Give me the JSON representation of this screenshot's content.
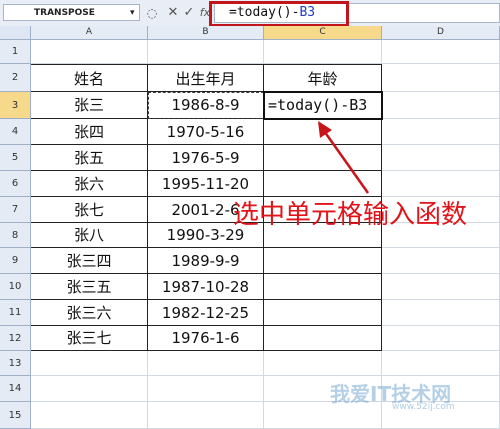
{
  "formula_bar": {
    "name_box": "TRANSPOSE",
    "cancel_icon": "✕",
    "enter_icon": "✓",
    "fx_icon": "fx",
    "formula_prefix": "=today()-",
    "formula_ref": "B3"
  },
  "columns": [
    "A",
    "B",
    "C",
    "D"
  ],
  "selected_column": "C",
  "rows": [
    "1",
    "2",
    "3",
    "4",
    "5",
    "6",
    "7",
    "8",
    "9",
    "10",
    "11",
    "12",
    "13",
    "14",
    "15"
  ],
  "selected_row": "3",
  "table": {
    "headers": [
      "姓名",
      "出生年月",
      "年龄"
    ],
    "records": [
      {
        "name": "张三",
        "birth": "1986-8-9",
        "age": "=today()-B3"
      },
      {
        "name": "张四",
        "birth": "1970-5-16",
        "age": ""
      },
      {
        "name": "张五",
        "birth": "1976-5-9",
        "age": ""
      },
      {
        "name": "张六",
        "birth": "1995-11-20",
        "age": ""
      },
      {
        "name": "张七",
        "birth": "2001-2-6",
        "age": ""
      },
      {
        "name": "张八",
        "birth": "1990-3-29",
        "age": ""
      },
      {
        "name": "张三四",
        "birth": "1989-9-9",
        "age": ""
      },
      {
        "name": "张三五",
        "birth": "1987-10-28",
        "age": ""
      },
      {
        "name": "张三六",
        "birth": "1982-12-25",
        "age": ""
      },
      {
        "name": "张三七",
        "birth": "1976-1-6",
        "age": ""
      }
    ]
  },
  "annotation": "选中单元格输入函数",
  "colors": {
    "callout": "#e0141b",
    "highlight_box": "#c0151b",
    "formula_ref": "#1f3cc7"
  },
  "watermark": {
    "text": "我爱IT技术网",
    "url": "www.52ij.com"
  }
}
